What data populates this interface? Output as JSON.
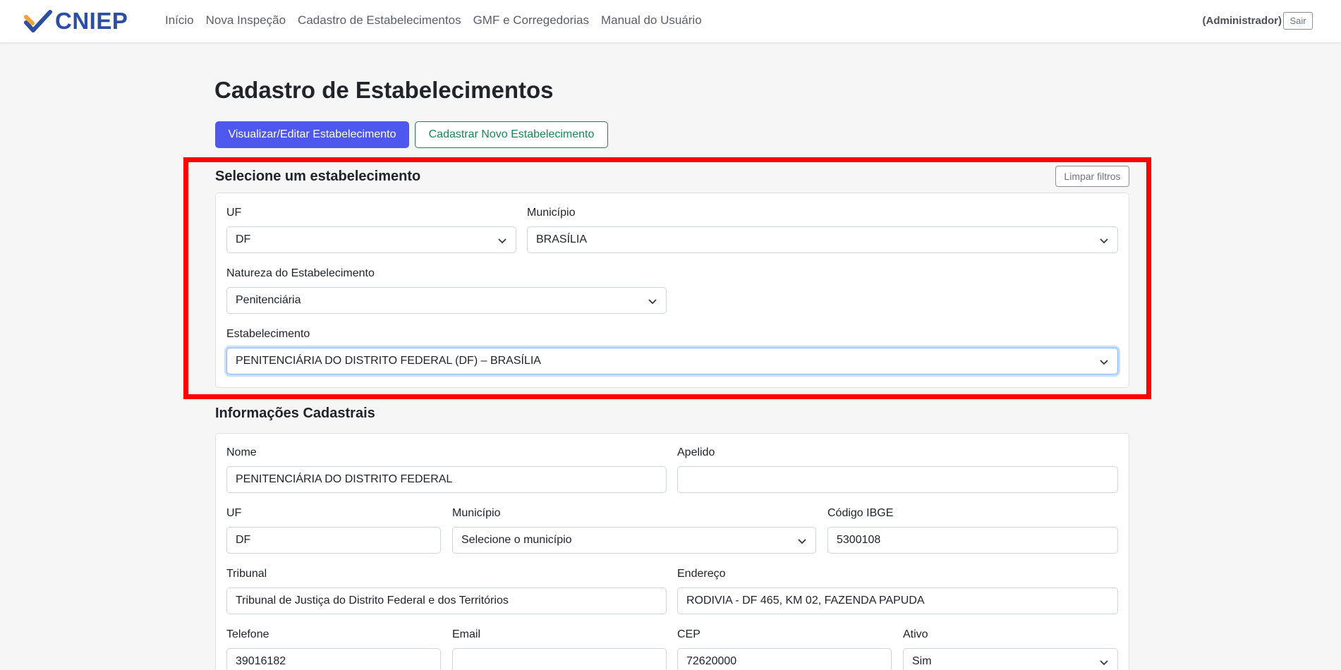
{
  "nav": {
    "brand": "CNIEP",
    "links": [
      "Início",
      "Nova Inspeção",
      "Cadastro de Estabelecimentos",
      "GMF e Corregedorias",
      "Manual do Usuário"
    ],
    "user": "(Administrador)",
    "logout": "Sair"
  },
  "page": {
    "title": "Cadastro de Estabelecimentos",
    "view_edit_button": "Visualizar/Editar Estabelecimento",
    "new_button": "Cadastrar Novo Estabelecimento"
  },
  "select_section": {
    "title": "Selecione um estabelecimento",
    "clear_button": "Limpar filtros",
    "uf_label": "UF",
    "uf_value": "DF",
    "municipio_label": "Município",
    "municipio_value": "BRASÍLIA",
    "natureza_label": "Natureza do Estabelecimento",
    "natureza_value": "Penitenciária",
    "estab_label": "Estabelecimento",
    "estab_value": "PENITENCIÁRIA DO DISTRITO FEDERAL (DF) – BRASÍLIA"
  },
  "info_section": {
    "title": "Informações Cadastrais",
    "nome_label": "Nome",
    "nome_value": "PENITENCIÁRIA DO DISTRITO FEDERAL",
    "apelido_label": "Apelido",
    "apelido_value": "",
    "uf_label": "UF",
    "uf_value": "DF",
    "municipio_label": "Município",
    "municipio_value": "Selecione o município",
    "ibge_label": "Código IBGE",
    "ibge_value": "5300108",
    "tribunal_label": "Tribunal",
    "tribunal_value": "Tribunal de Justiça do Distrito Federal e dos Territórios",
    "endereco_label": "Endereço",
    "endereco_value": "RODIVIA - DF 465, KM 02, FAZENDA PAPUDA",
    "telefone_label": "Telefone",
    "telefone_value": "39016182",
    "email_label": "Email",
    "email_value": "",
    "cep_label": "CEP",
    "cep_value": "72620000",
    "ativo_label": "Ativo",
    "ativo_value": "Sim"
  },
  "colors": {
    "primary": "#4e57ee",
    "success": "#198754",
    "brand": "#2c4fa3",
    "highlight": "#ff0000",
    "background": "#f6f6f7"
  }
}
